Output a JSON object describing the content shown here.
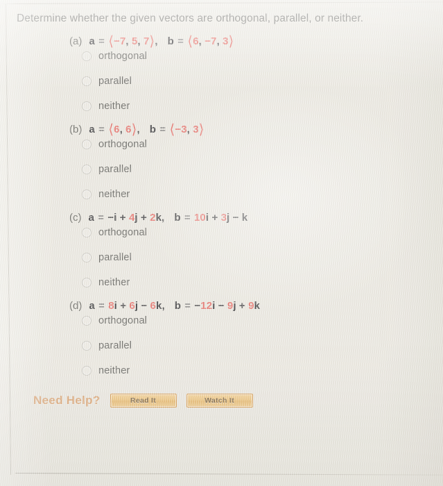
{
  "prompt": "Determine whether the given vectors are orthogonal, parallel, or neither.",
  "options": {
    "orthogonal": "orthogonal",
    "parallel": "parallel",
    "neither": "neither"
  },
  "parts": [
    {
      "label": "(a)",
      "a_name": "a",
      "b_name": "b",
      "a_vector": "⟨−7, 5, 7⟩",
      "b_vector": "⟨6, −7, 3⟩",
      "a_parts": [
        "−7",
        "5",
        "7"
      ],
      "b_parts": [
        "6",
        "−7",
        "3"
      ],
      "form": "angle-bracket"
    },
    {
      "label": "(b)",
      "a_name": "a",
      "b_name": "b",
      "a_vector": "⟨6, 6⟩",
      "b_vector": "⟨−3, 3⟩",
      "a_parts": [
        "6",
        "6"
      ],
      "b_parts": [
        "−3",
        "3"
      ],
      "form": "angle-bracket"
    },
    {
      "label": "(c)",
      "a_name": "a",
      "b_name": "b",
      "a_vector": "−i + 4j + 2k",
      "b_vector": "10i + 3j − k",
      "a_terms": [
        {
          "sign": "−",
          "coeff": "",
          "unit": "i"
        },
        {
          "sign": "+",
          "coeff": "4",
          "unit": "j"
        },
        {
          "sign": "+",
          "coeff": "2",
          "unit": "k"
        }
      ],
      "b_terms": [
        {
          "sign": "",
          "coeff": "10",
          "unit": "i"
        },
        {
          "sign": "+",
          "coeff": "3",
          "unit": "j"
        },
        {
          "sign": "−",
          "coeff": "",
          "unit": "k"
        }
      ],
      "form": "ijk"
    },
    {
      "label": "(d)",
      "a_name": "a",
      "b_name": "b",
      "a_vector": "8i + 6j − 6k",
      "b_vector": "−12i − 9j + 9k",
      "a_terms": [
        {
          "sign": "",
          "coeff": "8",
          "unit": "i"
        },
        {
          "sign": "+",
          "coeff": "6",
          "unit": "j"
        },
        {
          "sign": "−",
          "coeff": "6",
          "unit": "k"
        }
      ],
      "b_terms": [
        {
          "sign": "−",
          "coeff": "12",
          "unit": "i"
        },
        {
          "sign": "−",
          "coeff": "9",
          "unit": "j"
        },
        {
          "sign": "+",
          "coeff": "9",
          "unit": "k"
        }
      ],
      "form": "ijk"
    }
  ],
  "need_help": {
    "label": "Need Help?",
    "read_button": "Read It",
    "watch_button": "Watch It"
  },
  "colors": {
    "page_background": "#eceae3",
    "body_text": "#636360",
    "number_accent": "#e8736d",
    "need_help_text": "#dda87a",
    "button_fill": "#eec682",
    "button_border": "#d79a4e"
  }
}
